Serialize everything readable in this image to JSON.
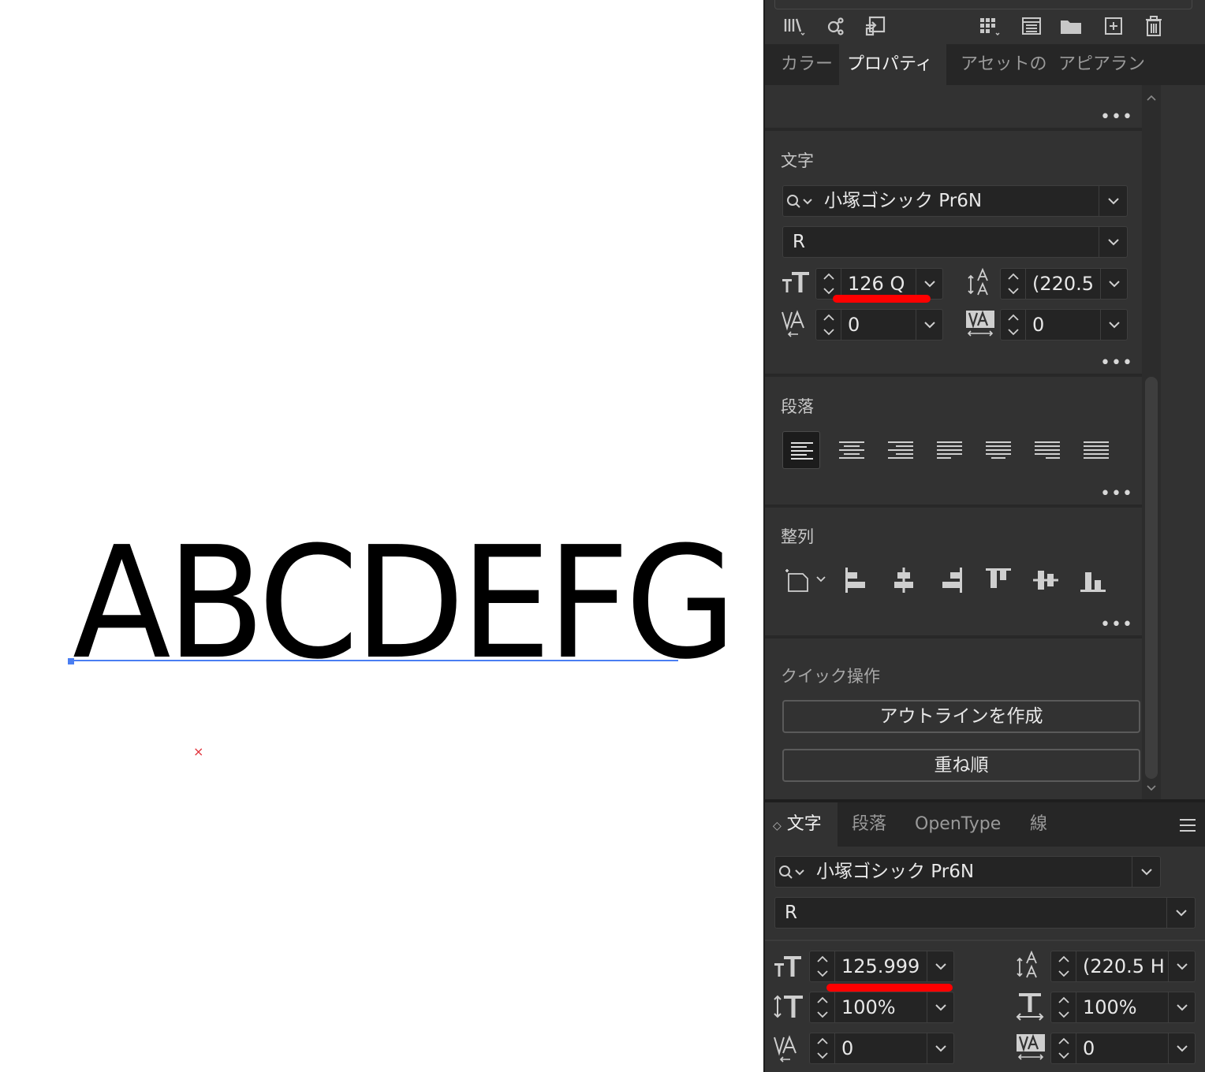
{
  "canvas": {
    "sample_text": "ABCDEFG",
    "origin_mark": "×"
  },
  "toolbar": {
    "icons": [
      "libraries-icon",
      "symbol-link-icon",
      "export-icon",
      "grid-icon",
      "list-icon",
      "folder-icon",
      "add-icon",
      "trash-icon"
    ]
  },
  "panel_tabs": [
    "カラー",
    "プロパティ",
    "アセットの",
    "アピアラン"
  ],
  "properties": {
    "more_label": "•••",
    "character": {
      "title": "文字",
      "font_family": "小塚ゴシック Pr6N",
      "font_style": "R",
      "font_size": "126 Q",
      "leading": "(220.5",
      "kerning": "0",
      "tracking": "0"
    },
    "paragraph": {
      "title": "段落",
      "align_options": [
        "align-left",
        "align-center",
        "align-right",
        "justify-left",
        "justify-center",
        "justify-right",
        "justify-all"
      ]
    },
    "align": {
      "title": "整列"
    },
    "quick_actions": {
      "title": "クイック操作",
      "create_outlines": "アウトラインを作成",
      "arrange": "重ね順"
    }
  },
  "character_panel": {
    "tabs": [
      "文字",
      "段落",
      "OpenType",
      "線"
    ],
    "tab_toggle": "◇",
    "font_family": "小塚ゴシック Pr6N",
    "font_style": "R",
    "font_size": "125.999",
    "leading": "(220.5 H",
    "vertical_scale": "100%",
    "horizontal_scale": "100%",
    "kerning": "0",
    "tracking": "0"
  },
  "annotation_color": "#ff0000"
}
